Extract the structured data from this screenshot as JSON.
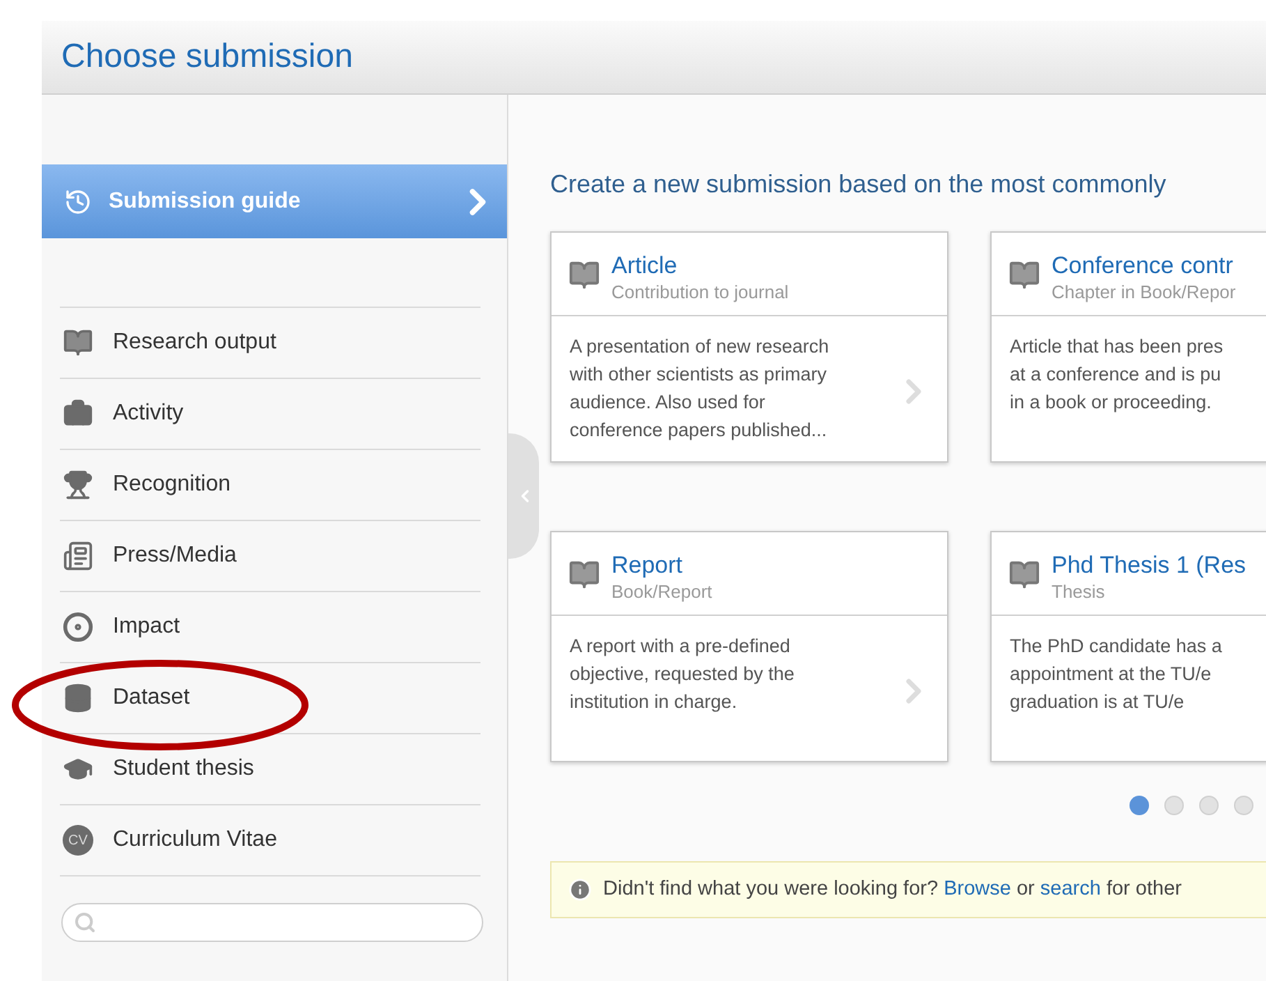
{
  "header": {
    "title": "Choose submission"
  },
  "sidebar": {
    "guide": {
      "label": "Submission guide"
    },
    "items": [
      {
        "label": "Research output",
        "kind": "book"
      },
      {
        "label": "Activity",
        "kind": "briefcase"
      },
      {
        "label": "Recognition",
        "kind": "trophy"
      },
      {
        "label": "Press/Media",
        "kind": "press"
      },
      {
        "label": "Impact",
        "kind": "target"
      },
      {
        "label": "Dataset",
        "kind": "database"
      },
      {
        "label": "Student thesis",
        "kind": "cap"
      },
      {
        "label": "Curriculum Vitae",
        "kind": "badge",
        "icon_text": "CV"
      }
    ],
    "search": {
      "kind": "search"
    }
  },
  "main": {
    "heading": "Create a new submission based on the most commonly",
    "cards": [
      {
        "title": "Article",
        "subtitle": "Contribution to journal",
        "lines": [
          "A presentation of new research",
          "with other scientists as primary",
          "audience. Also used for",
          "conference papers published..."
        ]
      },
      {
        "title": "Conference contr",
        "subtitle": "Chapter in Book/Repor",
        "lines": [
          "Article that has been pres",
          "at a conference and is pu",
          "in a book or proceeding."
        ]
      },
      {
        "title": "Report",
        "subtitle": "Book/Report",
        "lines": [
          "A report with a pre-defined",
          "objective, requested by the",
          "institution in charge."
        ]
      },
      {
        "title": "Phd Thesis 1 (Res",
        "subtitle": "Thesis",
        "lines": [
          "The PhD candidate has a",
          "appointment at the TU/e",
          "graduation is at TU/e"
        ]
      }
    ],
    "pages": [
      {
        "selected": true
      },
      {
        "selected": false
      },
      {
        "selected": false
      },
      {
        "selected": false
      }
    ],
    "notice": {
      "text": "Didn't find what you were looking for?",
      "link1": "Browse",
      "middle": "or",
      "link2": "search",
      "tail": "for other"
    }
  }
}
